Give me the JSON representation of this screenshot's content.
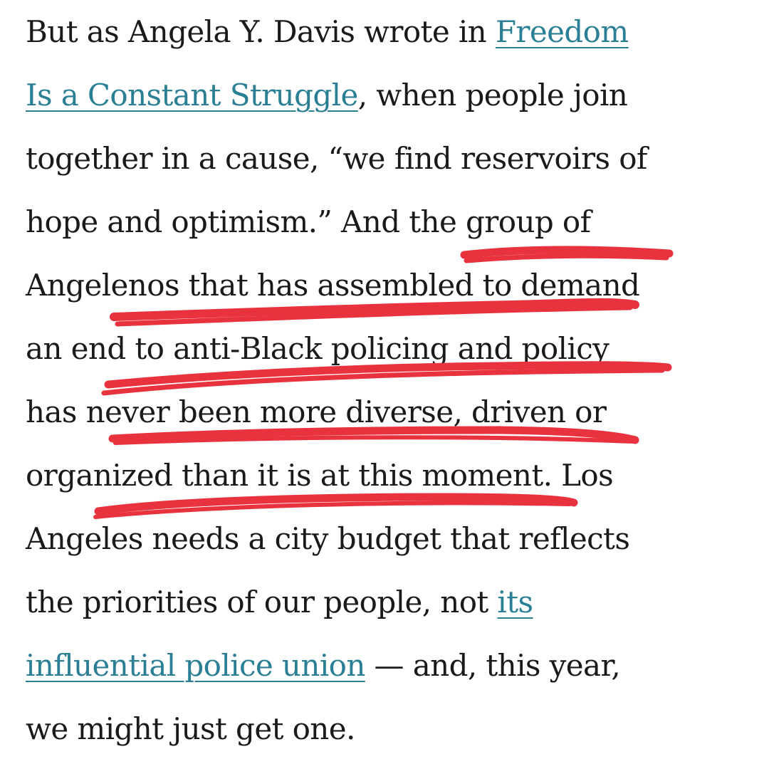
{
  "article": {
    "lines": [
      {
        "before": "But as Angela Y. Davis wrote in ",
        "link": "Freedom",
        "after": ""
      },
      {
        "before": "",
        "link": "Is a Constant Struggle",
        "after": ", when people join"
      },
      {
        "before": "together in a cause, “we find reservoirs of",
        "link": "",
        "after": ""
      },
      {
        "before": "hope and optimism.” And the group of",
        "link": "",
        "after": ""
      },
      {
        "before": "Angelenos that has assembled to demand",
        "link": "",
        "after": ""
      },
      {
        "before": "an end to anti-Black policing and policy",
        "link": "",
        "after": ""
      },
      {
        "before": "has never been more diverse, driven or",
        "link": "",
        "after": ""
      },
      {
        "before": "organized than it is at this moment. Los",
        "link": "",
        "after": ""
      },
      {
        "before": "Angeles needs a city budget that reflects",
        "link": "",
        "after": ""
      },
      {
        "before": "the priorities of our people, not ",
        "link": "its",
        "after": ""
      },
      {
        "before": "",
        "link": "influential police union",
        "after": " — and, this year,"
      },
      {
        "before": "we might just get one.",
        "link": "",
        "after": ""
      }
    ]
  },
  "colors": {
    "text": "#1a1a1a",
    "link": "#2a7f95",
    "highlight_underline": "#e8333f",
    "background": "#ffffff"
  }
}
